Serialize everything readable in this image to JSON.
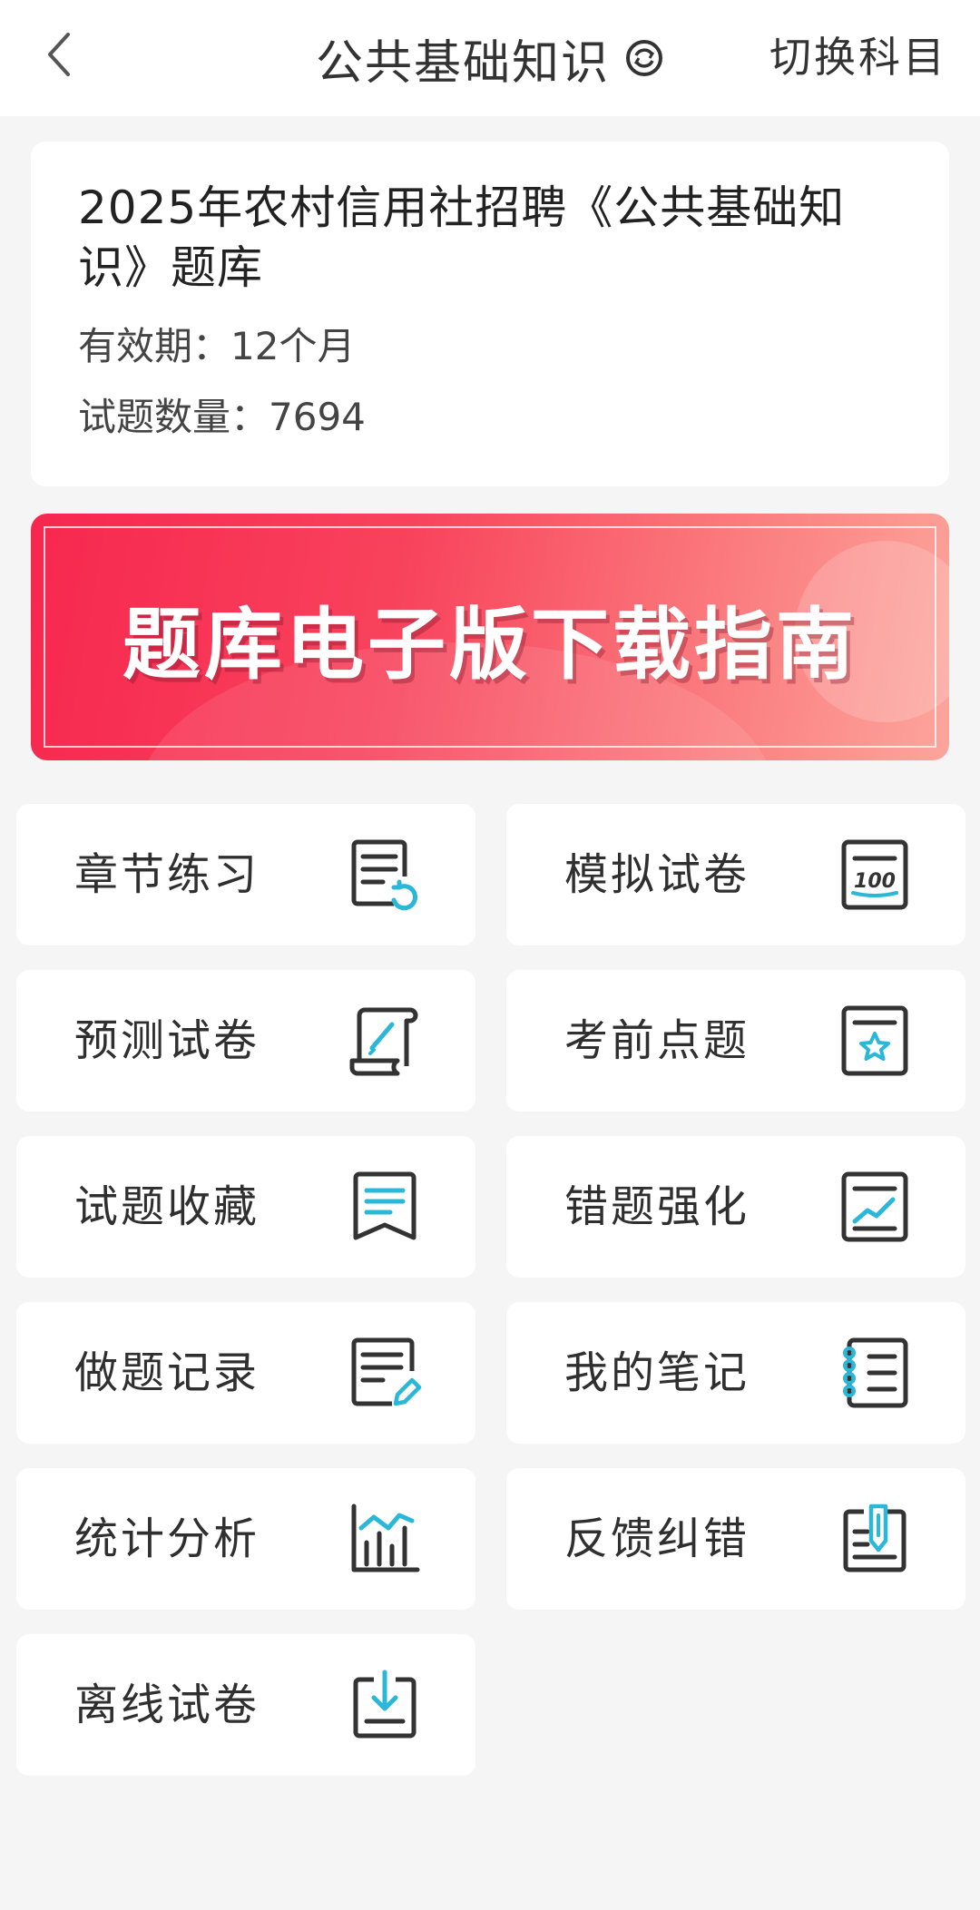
{
  "header": {
    "title": "公共基础知识",
    "back_icon": "chevron-left-icon",
    "refresh_icon": "refresh-icon",
    "switch_label": "切换科目"
  },
  "info": {
    "title": "2025年农村信用社招聘《公共基础知识》题库",
    "validity": "有效期：12个月",
    "count": "试题数量：7694"
  },
  "banner": {
    "text": "题库电子版下载指南"
  },
  "colors": {
    "accent": "#2ab7d8",
    "icon_stroke": "#333333",
    "banner_start": "#f7274f",
    "banner_end": "#fca59c"
  },
  "grid": [
    {
      "label": "章节练习",
      "icon": "chapter-practice-icon"
    },
    {
      "label": "模拟试卷",
      "icon": "mock-exam-100-icon"
    },
    {
      "label": "预测试卷",
      "icon": "scroll-pen-icon"
    },
    {
      "label": "考前点题",
      "icon": "star-document-icon"
    },
    {
      "label": "试题收藏",
      "icon": "bookmark-icon"
    },
    {
      "label": "错题强化",
      "icon": "trend-chart-icon"
    },
    {
      "label": "做题记录",
      "icon": "document-pen-icon"
    },
    {
      "label": "我的笔记",
      "icon": "notebook-icon"
    },
    {
      "label": "统计分析",
      "icon": "bar-chart-icon"
    },
    {
      "label": "反馈纠错",
      "icon": "feedback-pen-icon"
    },
    {
      "label": "离线试卷",
      "icon": "download-icon"
    }
  ]
}
